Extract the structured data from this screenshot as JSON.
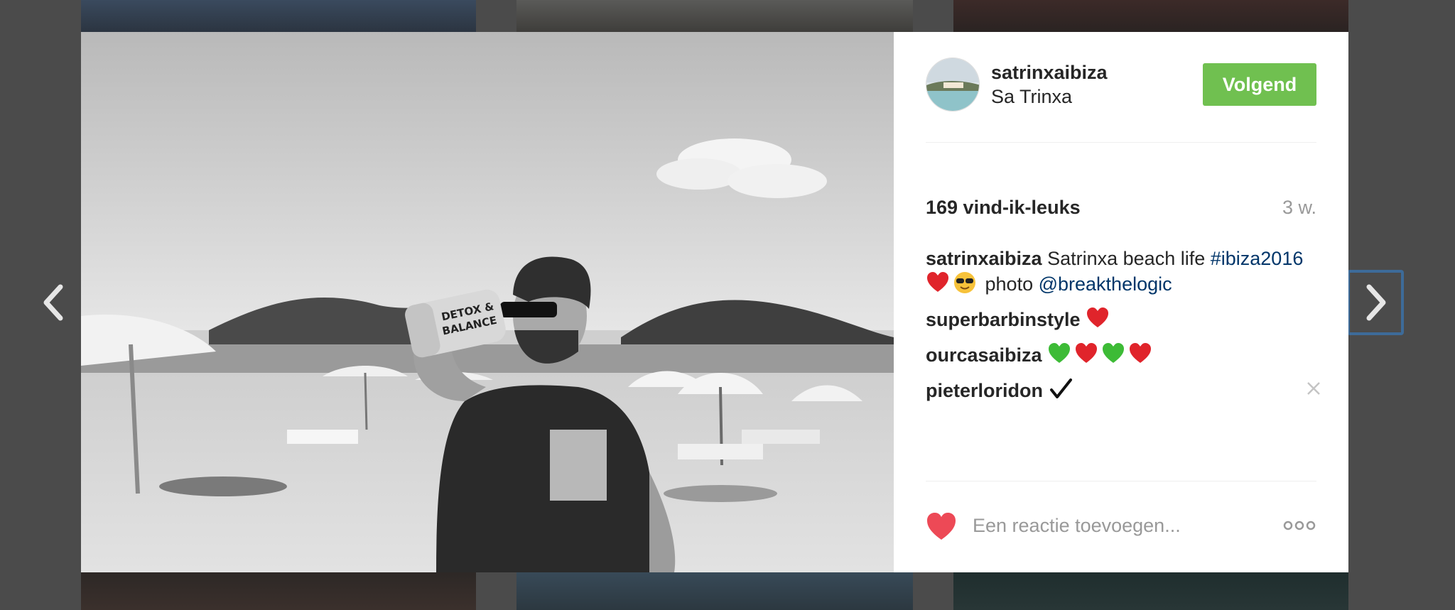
{
  "post": {
    "username": "satrinxaibiza",
    "location": "Sa Trinxa",
    "follow_label": "Volgend",
    "likes": "169 vind-ik-leuks",
    "time": "3 w.",
    "caption": {
      "author": "satrinxaibiza",
      "text": "Satrinxa beach life",
      "hashtag": "#ibiza2016",
      "text2": "photo",
      "mention": "@breakthelogic"
    },
    "comments": [
      {
        "author": "superbarbinstyle",
        "emojis": [
          "red-heart"
        ]
      },
      {
        "author": "ourcasaibiza",
        "emojis": [
          "green-heart",
          "red-heart",
          "green-heart",
          "red-heart"
        ]
      },
      {
        "author": "pieterloridon",
        "emojis": [
          "check-mark"
        ]
      }
    ],
    "comment_placeholder": "Een reactie toevoegen..."
  },
  "photo": {
    "bottle_text_1": "DETOX &",
    "bottle_text_2": "BALANCE"
  },
  "colors": {
    "follow_button": "#70c050",
    "link": "#003569",
    "like_heart": "#ed4956",
    "backdrop": "#4b4b4b"
  },
  "icons": {
    "prev": "chevron-left-icon",
    "next": "chevron-right-icon",
    "like": "heart-icon",
    "more": "more-options-icon",
    "delete": "close-icon"
  }
}
